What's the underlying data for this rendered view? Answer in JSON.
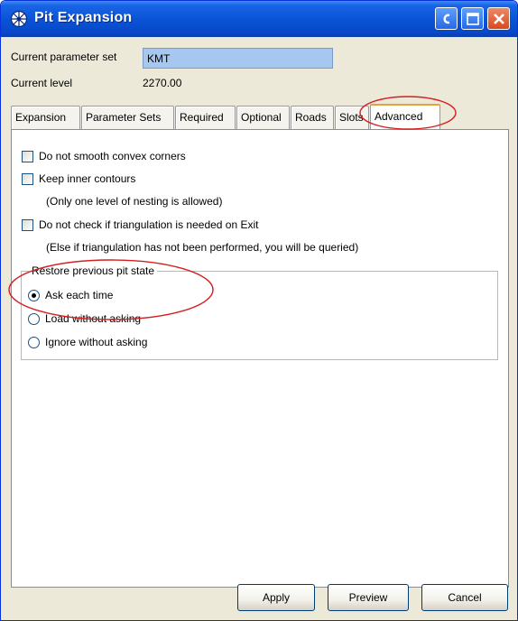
{
  "window": {
    "title": "Pit Expansion",
    "title_icon": "globe-icon",
    "controls": [
      "help-icon",
      "maximize-icon",
      "close-icon"
    ]
  },
  "form": {
    "param_set_label": "Current parameter set",
    "param_set_value": "KMT",
    "level_label": "Current level",
    "level_value": "2270.00"
  },
  "tabs": [
    {
      "label": "Expansion",
      "active": false
    },
    {
      "label": "Parameter Sets",
      "active": false
    },
    {
      "label": "Required",
      "active": false
    },
    {
      "label": "Optional",
      "active": false
    },
    {
      "label": "Roads",
      "active": false
    },
    {
      "label": "Slots",
      "active": false
    },
    {
      "label": "Advanced",
      "active": true
    }
  ],
  "advanced": {
    "no_smooth_label": "Do not smooth convex corners",
    "no_smooth_checked": false,
    "keep_inner_label": "Keep inner contours",
    "keep_inner_checked": false,
    "nesting_note": "(Only one level of nesting is allowed)",
    "no_check_tri_label": "Do not check if triangulation is needed on Exit",
    "no_check_tri_checked": false,
    "tri_note": "(Else if triangulation has not been performed, you will be queried)",
    "restore_group_title": "Restore previous pit state",
    "restore_options": [
      {
        "label": "Ask each time",
        "selected": true
      },
      {
        "label": "Load without asking",
        "selected": false
      },
      {
        "label": "Ignore without asking",
        "selected": false
      }
    ]
  },
  "buttons": {
    "apply": "Apply",
    "preview": "Preview",
    "cancel": "Cancel"
  },
  "colors": {
    "titlebar": "#0a54d8",
    "field_highlight": "#a6c8f0",
    "annotation": "#d42020",
    "window_bg": "#ece9d8"
  }
}
